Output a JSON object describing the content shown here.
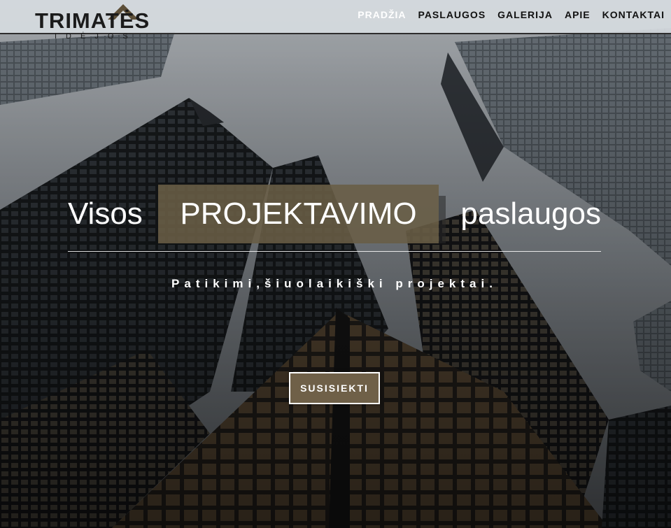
{
  "brand": {
    "name": "TRIMATĖS",
    "subtitle": "IDĖJOS"
  },
  "nav": {
    "items": [
      {
        "label": "PRADŽIA",
        "active": true
      },
      {
        "label": "PASLAUGOS",
        "active": false
      },
      {
        "label": "GALERIJA",
        "active": false
      },
      {
        "label": "APIE",
        "active": false
      },
      {
        "label": "KONTAKTAI",
        "active": false
      }
    ]
  },
  "hero": {
    "headline_left": "Visos",
    "headline_highlight": "PROJEKTAVIMO",
    "headline_right": "paslaugos",
    "tagline": "Patikimi,šiuolaikiški projektai.",
    "cta_label": "SUSISIEKTI"
  },
  "colors": {
    "accent": "#6f6048",
    "header_bg": "#d6dbe0",
    "text_on_hero": "#ffffff"
  }
}
